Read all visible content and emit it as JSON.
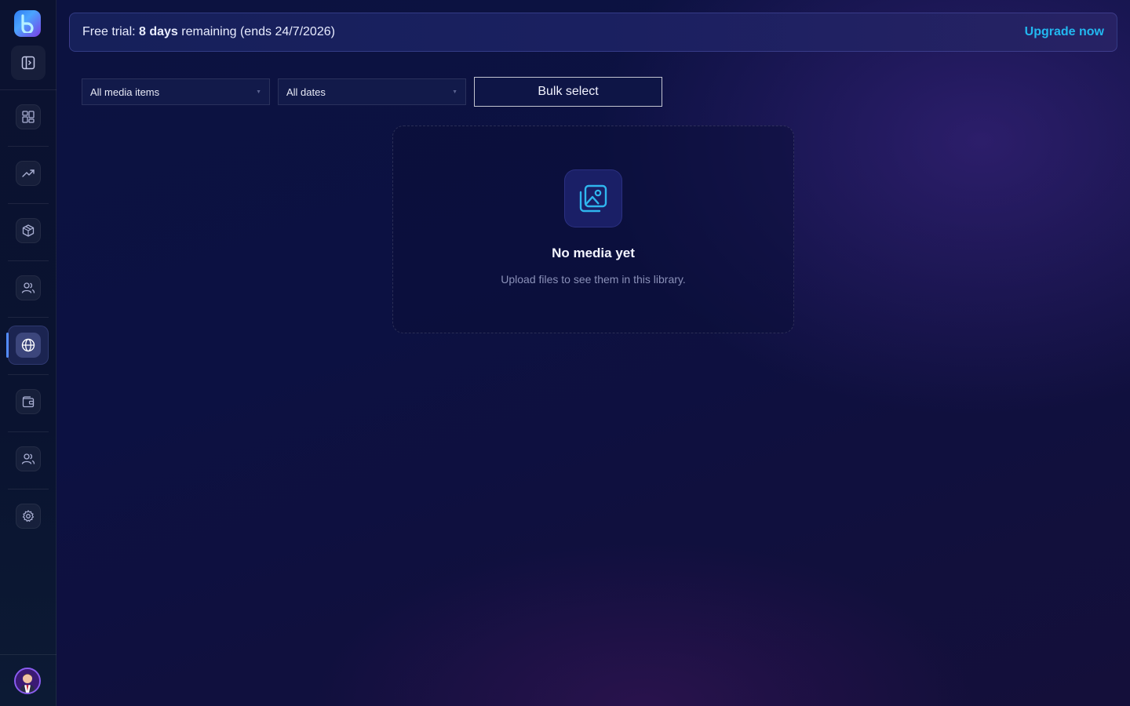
{
  "banner": {
    "prefix": "Free trial: ",
    "days": "8 days",
    "suffix": " remaining (ends 24/7/2026)",
    "upgrade_label": "Upgrade now"
  },
  "filters": {
    "media_type": "All media items",
    "dates": "All dates",
    "bulk_select_label": "Bulk select"
  },
  "empty_state": {
    "title": "No media yet",
    "subtitle": "Upload files to see them in this library."
  },
  "sidebar": {
    "items": [
      {
        "icon": "dashboard-icon"
      },
      {
        "icon": "trending-icon"
      },
      {
        "icon": "box-icon"
      },
      {
        "icon": "users-icon"
      },
      {
        "icon": "globe-icon",
        "active": true
      },
      {
        "icon": "wallet-icon"
      },
      {
        "icon": "team-icon"
      },
      {
        "icon": "gear-icon"
      }
    ]
  },
  "colors": {
    "accent": "#22b8f0",
    "active_indicator": "#4f8cff"
  }
}
